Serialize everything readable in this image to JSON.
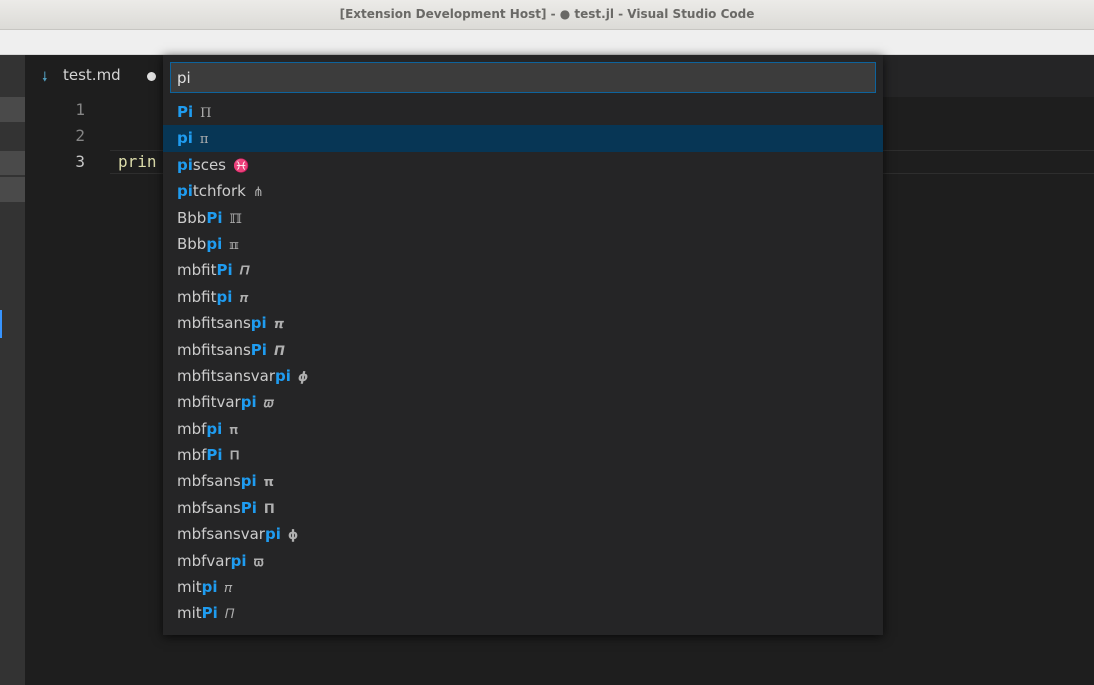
{
  "window": {
    "title": "[Extension Development Host] - ● test.jl - Visual Studio Code"
  },
  "tabs": [
    {
      "label": "test.md",
      "icon": "markdown-icon",
      "dirty": true
    }
  ],
  "editor": {
    "line_numbers": [
      "1",
      "2",
      "3"
    ],
    "active_line": "3",
    "lines": [
      "",
      "",
      "prin"
    ]
  },
  "quick_pick": {
    "input_value": "pi",
    "selected_index": 1,
    "items": [
      {
        "prefix": "",
        "match": "Pi",
        "suffix": "",
        "symbol": "Π"
      },
      {
        "prefix": "",
        "match": "pi",
        "suffix": "",
        "symbol": "π"
      },
      {
        "prefix": "",
        "match": "pi",
        "suffix": "sces",
        "symbol": "♓"
      },
      {
        "prefix": "",
        "match": "pi",
        "suffix": "tchfork",
        "symbol": "⋔"
      },
      {
        "prefix": "Bbb",
        "match": "Pi",
        "suffix": "",
        "symbol": "ℿ"
      },
      {
        "prefix": "Bbb",
        "match": "pi",
        "suffix": "",
        "symbol": "ℼ"
      },
      {
        "prefix": "mbfit",
        "match": "Pi",
        "suffix": "",
        "symbol": "𝜫"
      },
      {
        "prefix": "mbfit",
        "match": "pi",
        "suffix": "",
        "symbol": "𝝅"
      },
      {
        "prefix": "mbfitsans",
        "match": "pi",
        "suffix": "",
        "symbol": "𝞹"
      },
      {
        "prefix": "mbfitsans",
        "match": "Pi",
        "suffix": "",
        "symbol": "𝞟"
      },
      {
        "prefix": "mbfitsansvar",
        "match": "pi",
        "suffix": "",
        "symbol": "𝟇"
      },
      {
        "prefix": "mbfitvar",
        "match": "pi",
        "suffix": "",
        "symbol": "𝝕"
      },
      {
        "prefix": "mbf",
        "match": "pi",
        "suffix": "",
        "symbol": "𝛑"
      },
      {
        "prefix": "mbf",
        "match": "Pi",
        "suffix": "",
        "symbol": "𝚷"
      },
      {
        "prefix": "mbfsans",
        "match": "pi",
        "suffix": "",
        "symbol": "𝝿"
      },
      {
        "prefix": "mbfsans",
        "match": "Pi",
        "suffix": "",
        "symbol": "𝝥"
      },
      {
        "prefix": "mbfsansvar",
        "match": "pi",
        "suffix": "",
        "symbol": "𝞍"
      },
      {
        "prefix": "mbfvar",
        "match": "pi",
        "suffix": "",
        "symbol": "𝛡"
      },
      {
        "prefix": "mit",
        "match": "pi",
        "suffix": "",
        "symbol": "𝜋"
      },
      {
        "prefix": "mit",
        "match": "Pi",
        "suffix": "",
        "symbol": "𝛱"
      }
    ]
  },
  "colors": {
    "match_highlight": "#1f9cf0",
    "selection_background": "#073655",
    "focus_border": "#0e639c"
  }
}
